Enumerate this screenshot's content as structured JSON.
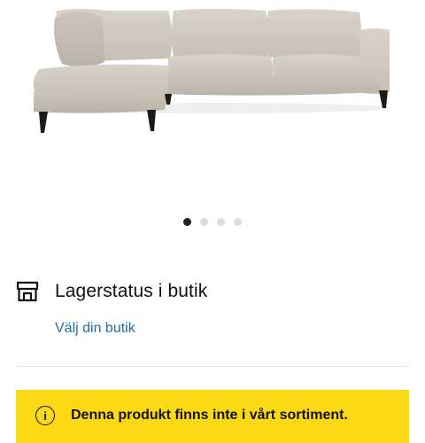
{
  "product": {
    "image_name": "corner-sofa-light-beige",
    "carousel": {
      "count": 4,
      "active_index": 0
    }
  },
  "stock": {
    "icon": "store-icon",
    "title": "Lagerstatus i butik",
    "link": "Välj din butik"
  },
  "notice": {
    "icon": "info-icon",
    "text": "Denna produkt finns inte i vårt sortiment.",
    "background": "#fbd914"
  },
  "colors": {
    "link": "#1f6fa9",
    "dot_active": "#222222",
    "dot_inactive": "#dcdcdc"
  }
}
